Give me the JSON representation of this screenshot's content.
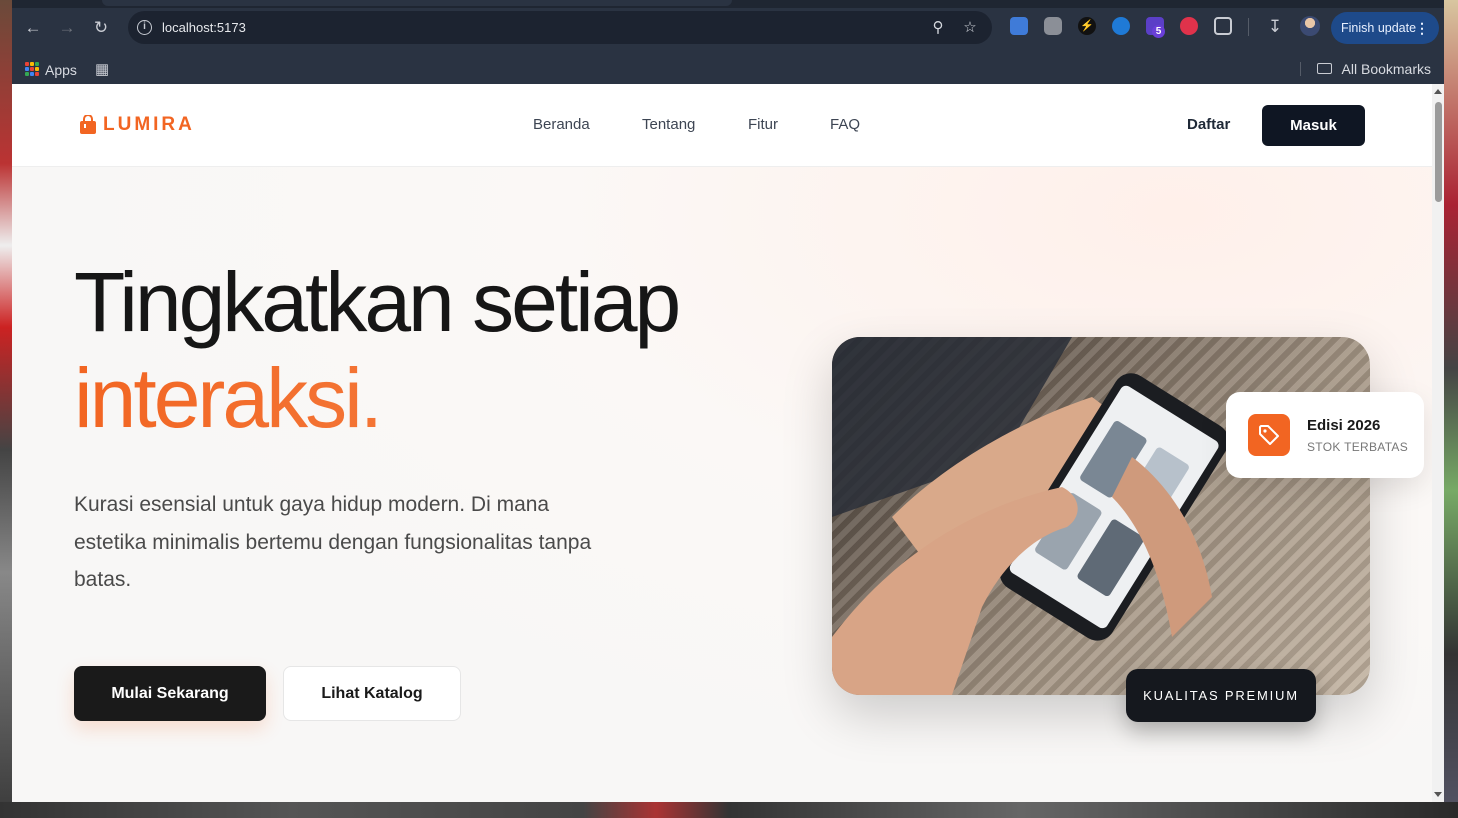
{
  "browser": {
    "url": "localhost:5173",
    "finish_update_label": "Finish update",
    "bookmarks": {
      "apps_label": "Apps",
      "all_bookmarks_label": "All Bookmarks"
    },
    "extension_badge": "5"
  },
  "site": {
    "brand": "LUMIRA",
    "brand_color": "#f26522",
    "nav": [
      "Beranda",
      "Tentang",
      "Fitur",
      "FAQ"
    ],
    "daftar_label": "Daftar",
    "masuk_label": "Masuk"
  },
  "hero": {
    "title_line1": "Tingkatkan setiap",
    "title_line2": "interaksi.",
    "description": "Kurasi esensial untuk gaya hidup modern. Di mana estetika minimalis bertemu dengan fungsionalitas tanpa batas.",
    "primary_cta": "Mulai Sekarang",
    "secondary_cta": "Lihat Katalog",
    "badge_title": "Edisi 2026",
    "badge_subtitle": "STOK TERBATAS",
    "premium_label": "KUALITAS PREMIUM",
    "accent_color": "#f26522",
    "dark_color": "#1a1a1a"
  }
}
